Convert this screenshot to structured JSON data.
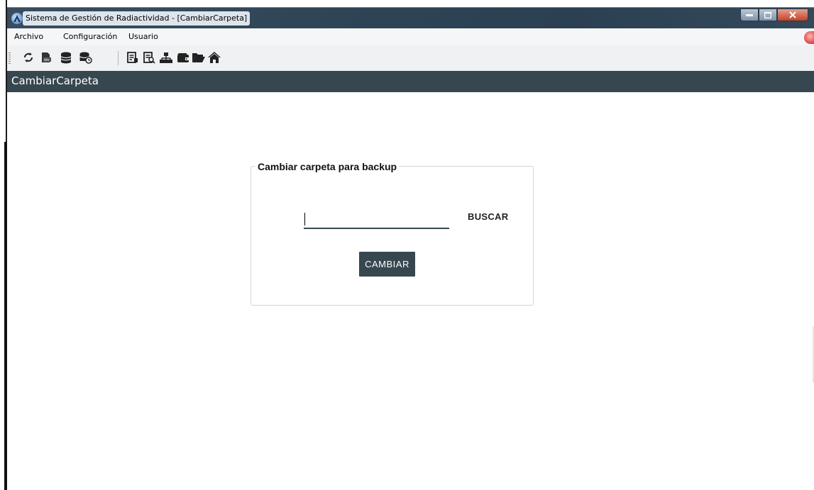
{
  "window": {
    "title": "Sistema de Gestión de Radiactividad - [CambiarCarpeta]",
    "controls": [
      "minimize",
      "maximize",
      "close"
    ]
  },
  "menubar": {
    "items": [
      {
        "label": "Archivo"
      },
      {
        "label": "Configuración"
      },
      {
        "label": "Usuario"
      }
    ]
  },
  "toolbar": {
    "icons": [
      "refresh-icon",
      "xls-export-icon",
      "database-icon",
      "database-restore-icon",
      "report-icon",
      "report-search-icon",
      "network-icon",
      "wallet-icon",
      "folder-open-icon",
      "home-icon"
    ]
  },
  "header": {
    "title": "CambiarCarpeta"
  },
  "form": {
    "legend": "Cambiar carpeta para backup",
    "path_value": "",
    "buscar_label": "BUSCAR",
    "cambiar_label": "CAMBIAR"
  },
  "colors": {
    "header_bg": "#37474f",
    "button_bg": "#37474f",
    "titlebar_bg": "#2f4556"
  }
}
